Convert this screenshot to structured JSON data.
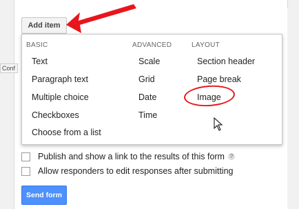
{
  "toolbar": {
    "add_item_label": "Add item"
  },
  "sidebar": {
    "tab_label": "Conf"
  },
  "menu": {
    "basic": {
      "header": "BASIC",
      "items": [
        "Text",
        "Paragraph text",
        "Multiple choice",
        "Checkboxes",
        "Choose from a list"
      ]
    },
    "advanced": {
      "header": "ADVANCED",
      "items": [
        "Scale",
        "Grid",
        "Date",
        "Time"
      ]
    },
    "layout": {
      "header": "LAYOUT",
      "items": [
        "Section header",
        "Page break",
        "Image"
      ]
    }
  },
  "settings": {
    "publish_results": "Publish and show a link to the results of this form",
    "help_icon": "?",
    "allow_edit": "Allow responders to edit responses after submitting"
  },
  "footer": {
    "send_form_label": "Send form"
  },
  "colors": {
    "accent": "#4d90fe",
    "annotation": "#e8161c"
  },
  "icons": [
    "arrow-annotation-icon",
    "help-icon",
    "mouse-cursor-icon"
  ]
}
